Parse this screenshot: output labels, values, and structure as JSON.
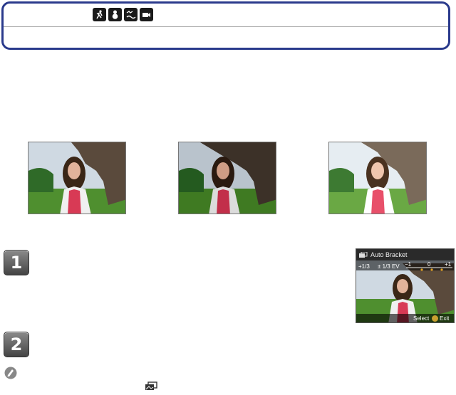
{
  "mode_icons": [
    "running-person-icon",
    "snowman-icon",
    "bird-wave-icon",
    "movie-camera-icon"
  ],
  "photos": [
    "photo-standard",
    "photo-underexposed",
    "photo-overexposed"
  ],
  "steps": {
    "step1": "1",
    "step2": "2"
  },
  "menu_screen": {
    "title": "Auto Bracket",
    "step_value": "+1/3",
    "ev_label": "± 1/3 EV",
    "scale": [
      "−1",
      "0",
      "+1"
    ],
    "footer_select": "Select",
    "footer_exit": "Exit"
  },
  "colors": {
    "box_border": "#2a3a8c",
    "step_fill": "#666666"
  }
}
